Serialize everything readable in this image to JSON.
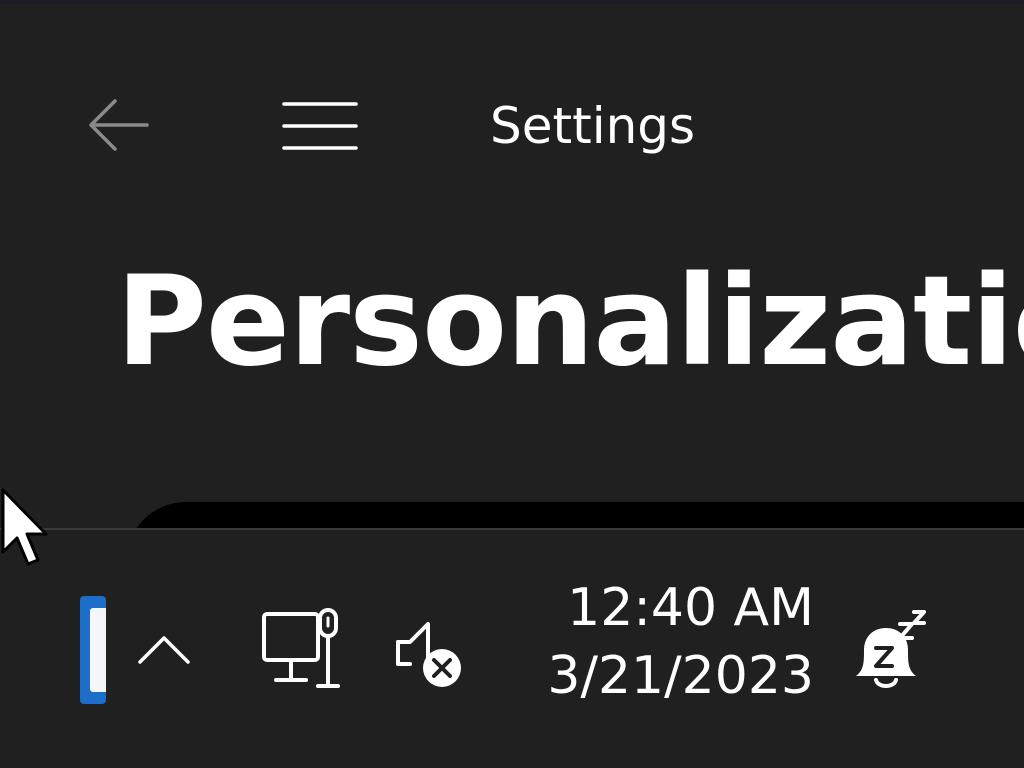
{
  "colors": {
    "background": "#202020",
    "text": "#ffffff",
    "back_arrow": "#8a8a8a",
    "taskbar_accent": "#1d6ec8"
  },
  "window": {
    "app_title": "Settings",
    "page_title": "Personalization",
    "back_icon": "arrow-left-icon",
    "menu_icon": "hamburger-menu-icon"
  },
  "taskbar": {
    "tray": {
      "chevron_icon": "chevron-up-icon",
      "network_icon": "wired-network-icon",
      "volume_icon": "volume-muted-icon"
    },
    "clock": {
      "time": "12:40 AM",
      "date": "3/21/2023"
    },
    "notification_icon": "do-not-disturb-bell-icon"
  }
}
